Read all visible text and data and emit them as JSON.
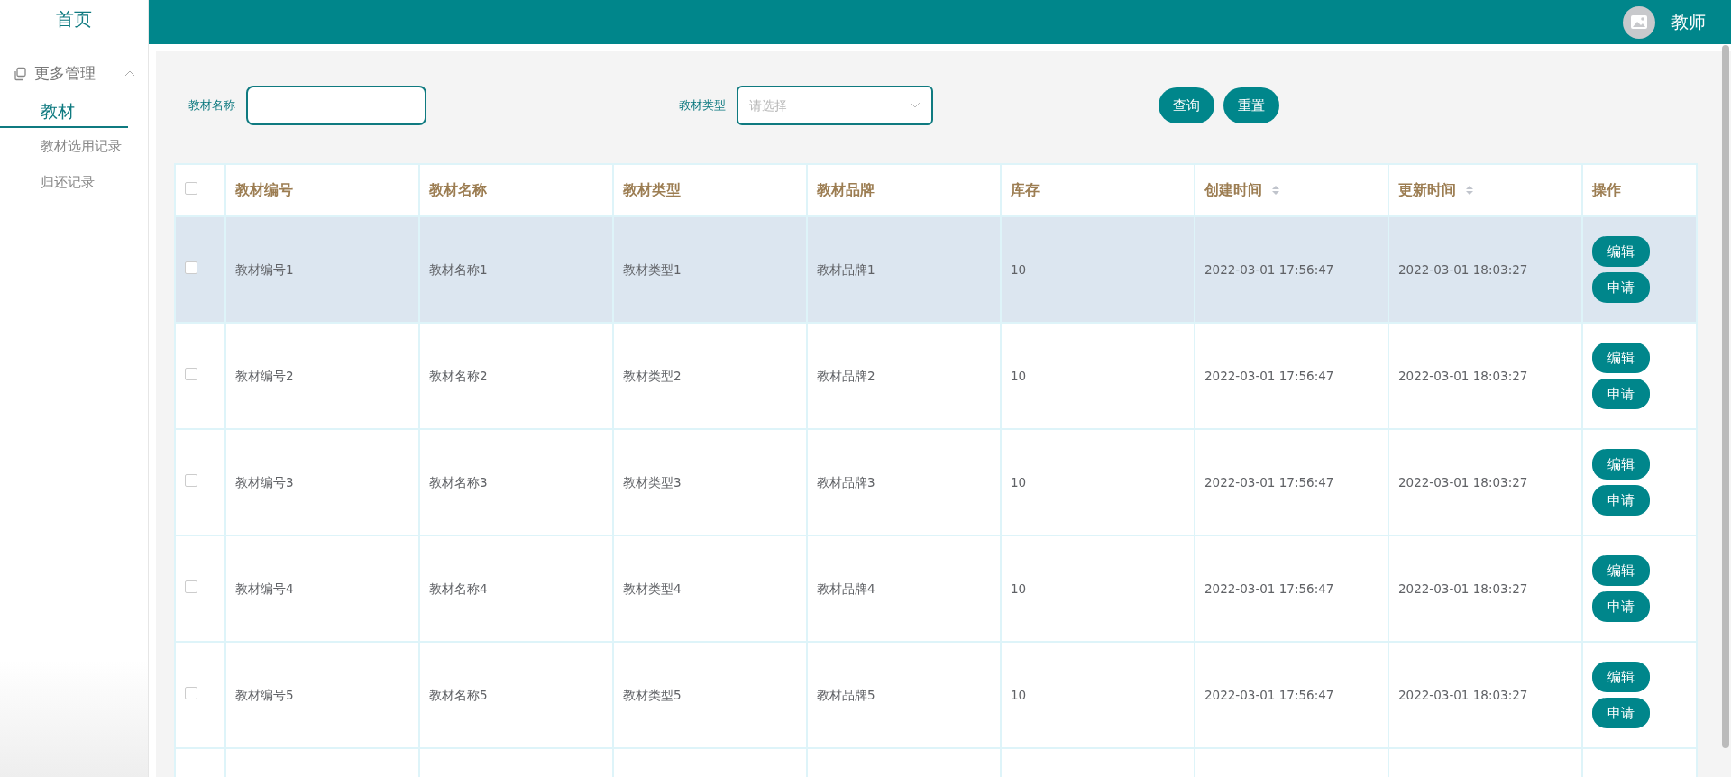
{
  "sidebar": {
    "home": "首页",
    "groups": [
      {
        "label": "更多管理",
        "expanded": true,
        "items": [
          {
            "label": "教材",
            "selected": true
          },
          {
            "label": "教材选用记录",
            "selected": false
          },
          {
            "label": "归还记录",
            "selected": false
          }
        ]
      }
    ]
  },
  "header": {
    "user": "教师"
  },
  "search": {
    "fields": [
      {
        "kind": "text",
        "label": "教材名称"
      },
      {
        "kind": "select",
        "label": "教材类型",
        "placeholder": "请选择"
      }
    ],
    "buttons": [
      "查询",
      "重置"
    ]
  },
  "table": {
    "columns": [
      {
        "label": "教材编号",
        "sortable": false
      },
      {
        "label": "教材名称",
        "sortable": false
      },
      {
        "label": "教材类型",
        "sortable": false
      },
      {
        "label": "教材品牌",
        "sortable": false
      },
      {
        "label": "库存",
        "sortable": false
      },
      {
        "label": "创建时间",
        "sortable": true
      },
      {
        "label": "更新时间",
        "sortable": true
      },
      {
        "label": "操作",
        "sortable": false
      }
    ],
    "select_all_checked": false,
    "rows": [
      {
        "highlighted": true,
        "checked": false,
        "cells": [
          "教材编号1",
          "教材名称1",
          "教材类型1",
          "教材品牌1",
          "10",
          "2022-03-01 17:56:47",
          "2022-03-01 18:03:27"
        ],
        "actions": [
          "编辑",
          "申请"
        ]
      },
      {
        "highlighted": false,
        "checked": false,
        "cells": [
          "教材编号2",
          "教材名称2",
          "教材类型2",
          "教材品牌2",
          "10",
          "2022-03-01 17:56:47",
          "2022-03-01 18:03:27"
        ],
        "actions": [
          "编辑",
          "申请"
        ]
      },
      {
        "highlighted": false,
        "checked": false,
        "cells": [
          "教材编号3",
          "教材名称3",
          "教材类型3",
          "教材品牌3",
          "10",
          "2022-03-01 17:56:47",
          "2022-03-01 18:03:27"
        ],
        "actions": [
          "编辑",
          "申请"
        ]
      },
      {
        "highlighted": false,
        "checked": false,
        "cells": [
          "教材编号4",
          "教材名称4",
          "教材类型4",
          "教材品牌4",
          "10",
          "2022-03-01 17:56:47",
          "2022-03-01 18:03:27"
        ],
        "actions": [
          "编辑",
          "申请"
        ]
      },
      {
        "highlighted": false,
        "checked": false,
        "cells": [
          "教材编号5",
          "教材名称5",
          "教材类型5",
          "教材品牌5",
          "10",
          "2022-03-01 17:56:47",
          "2022-03-01 18:03:27"
        ],
        "actions": [
          "编辑",
          "申请"
        ]
      }
    ]
  }
}
